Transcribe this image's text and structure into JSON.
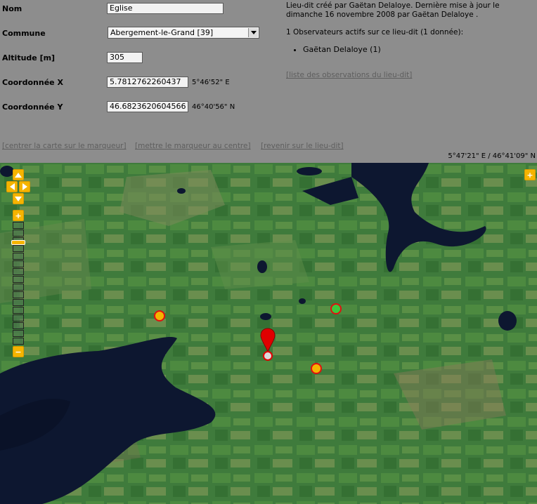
{
  "form": {
    "nom_label": "Nom",
    "nom_value": "Eglise",
    "commune_label": "Commune",
    "commune_value": "Abergement-le-Grand [39]",
    "altitude_label": "Altitude [m]",
    "altitude_value": "305",
    "x_label": "Coordonnée X",
    "x_value": "5.7812762260437",
    "x_dms": "5°46'52\" E",
    "y_label": "Coordonnée Y",
    "y_value": "46.6823620604566",
    "y_dms": "46°40'56\" N"
  },
  "info": {
    "line1": "Lieu-dit créé par Gaëtan Delaloye. Dernière mise à jour le",
    "line2": "dimanche 16 novembre 2008 par Gaëtan Delaloye .",
    "observers_heading": "1 Observateurs actifs sur ce lieu-dit (1 donnée):",
    "observers": [
      "Gaëtan Delaloye (1)"
    ],
    "obs_link": "[liste des observations du lieu-dit]"
  },
  "actions": {
    "center_map": "[centrer la carte sur le marqueur]",
    "move_marker": "[mettre le marqueur au centre]",
    "back": "[revenir sur le lieu-dit]"
  },
  "map": {
    "cursor_coords": "5°47'21\" E / 46°41'09\" N",
    "controls": {
      "pan_up_icon": "arrow-up-icon",
      "pan_left_icon": "arrow-left-icon",
      "pan_right_icon": "arrow-right-icon",
      "pan_down_icon": "arrow-down-icon",
      "zoom_in_glyph": "+",
      "zoom_out_glyph": "−",
      "expand_glyph": "+"
    },
    "colors": {
      "pin": "#e00000",
      "marker_yellow": "#f5b400",
      "marker_green": "#3cc83c",
      "marker_ring": "#e01010",
      "control": "#f5b400"
    }
  }
}
